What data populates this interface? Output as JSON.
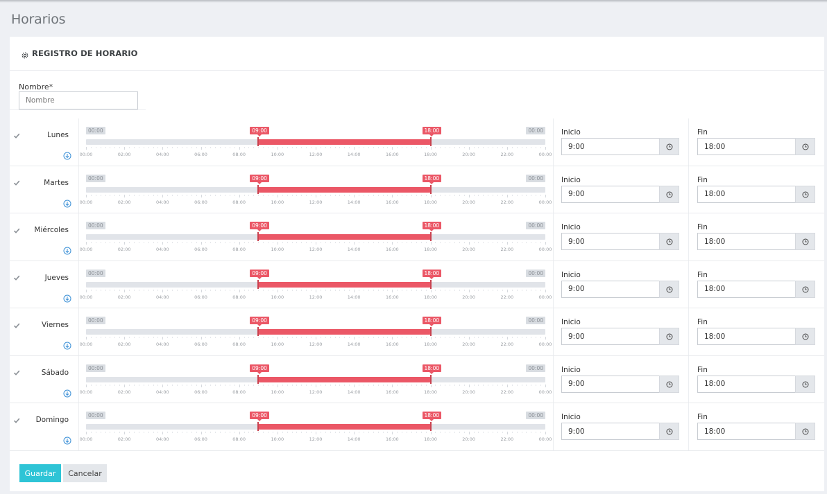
{
  "page": {
    "title": "Horarios"
  },
  "form": {
    "header": "REGISTRO DE HORARIO",
    "name_label": "Nombre*",
    "name_placeholder": "Nombre",
    "name_value": ""
  },
  "slider_ticks": [
    "00:00",
    "02:00",
    "04:00",
    "06:00",
    "08:00",
    "10:00",
    "12:00",
    "14:00",
    "16:00",
    "18:00",
    "20:00",
    "22:00",
    "00:00"
  ],
  "slider": {
    "min_label": "00:00",
    "max_label": "00:00",
    "min_hours": 0,
    "max_hours": 24
  },
  "fields": {
    "start_label": "Inicio",
    "end_label": "Fin"
  },
  "days": [
    {
      "name": "Lunes",
      "checked": true,
      "from_label": "09:00",
      "to_label": "18:00",
      "from_hours": 9,
      "to_hours": 18,
      "start_value": "9:00",
      "end_value": "18:00"
    },
    {
      "name": "Martes",
      "checked": true,
      "from_label": "09:00",
      "to_label": "18:00",
      "from_hours": 9,
      "to_hours": 18,
      "start_value": "9:00",
      "end_value": "18:00"
    },
    {
      "name": "Miércoles",
      "checked": true,
      "from_label": "09:00",
      "to_label": "18:00",
      "from_hours": 9,
      "to_hours": 18,
      "start_value": "9:00",
      "end_value": "18:00"
    },
    {
      "name": "Jueves",
      "checked": true,
      "from_label": "09:00",
      "to_label": "18:00",
      "from_hours": 9,
      "to_hours": 18,
      "start_value": "9:00",
      "end_value": "18:00"
    },
    {
      "name": "Viernes",
      "checked": true,
      "from_label": "09:00",
      "to_label": "18:00",
      "from_hours": 9,
      "to_hours": 18,
      "start_value": "9:00",
      "end_value": "18:00"
    },
    {
      "name": "Sábado",
      "checked": true,
      "from_label": "09:00",
      "to_label": "18:00",
      "from_hours": 9,
      "to_hours": 18,
      "start_value": "9:00",
      "end_value": "18:00"
    },
    {
      "name": "Domingo",
      "checked": true,
      "from_label": "09:00",
      "to_label": "18:00",
      "from_hours": 9,
      "to_hours": 18,
      "start_value": "9:00",
      "end_value": "18:00"
    }
  ],
  "buttons": {
    "save": "Guardar",
    "cancel": "Cancelar"
  },
  "colors": {
    "accent": "#eb5766",
    "primary_button": "#2ec4d6",
    "track": "#e1e4e9"
  },
  "icons": {
    "header": "gear-icon",
    "row_toggle": "arrow-down-circle-icon",
    "time_addon": "clock-icon",
    "check": "check-icon"
  }
}
